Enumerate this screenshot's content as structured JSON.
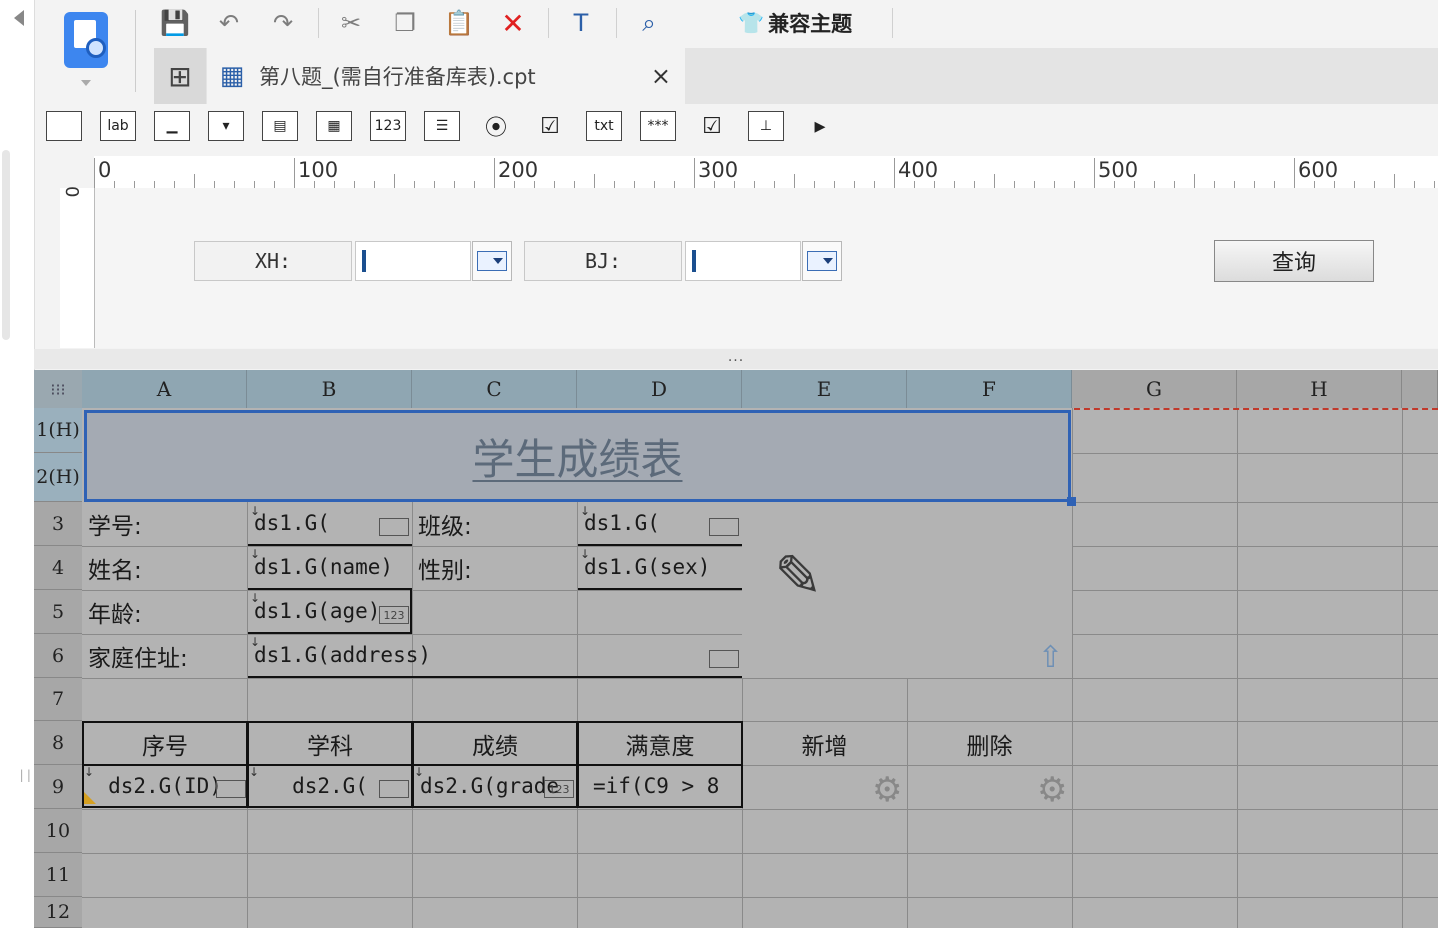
{
  "toolbar": {
    "icons": [
      "save-icon",
      "undo-icon",
      "redo-icon",
      "cut-icon",
      "copy-icon",
      "paste-icon",
      "delete-icon",
      "text-preview-icon",
      "chart-preview-icon"
    ],
    "theme_label": "兼容主题"
  },
  "tab": {
    "file_name": "第八题_(需自行准备库表).cpt",
    "close": "×"
  },
  "widgets": {
    "label_widget": "lab",
    "number_widget": "123",
    "text_widget": "txt",
    "password_widget": "***"
  },
  "ruler": {
    "labels": [
      "0",
      "100",
      "200",
      "300",
      "400",
      "500",
      "600"
    ],
    "left_label": "0"
  },
  "params": {
    "xh_label": "XH:",
    "bj_label": "BJ:",
    "query_button": "查询"
  },
  "divider": "...",
  "grid": {
    "columns": [
      "A",
      "B",
      "C",
      "D",
      "E",
      "F",
      "G",
      "H"
    ],
    "rows": [
      "1(H)",
      "2(H)",
      "3",
      "4",
      "5",
      "6",
      "7",
      "8",
      "9",
      "10",
      "11",
      "12"
    ],
    "title": "学生成绩表",
    "cells": {
      "a3": "学号:",
      "b3": "ds1.G(",
      "c3": "班级:",
      "d3": "ds1.G(",
      "a4": "姓名:",
      "b4": "ds1.G(name)",
      "c4": "性别:",
      "d4": "ds1.G(sex)",
      "a5": "年龄:",
      "b5": "ds1.G(age)",
      "a6": "家庭住址:",
      "b6": "ds1.G(address)",
      "a8": "序号",
      "b8": "学科",
      "c8": "成绩",
      "d8": "满意度",
      "e8": "新增",
      "f8": "删除",
      "a9": "ds2.G(ID)",
      "b9": "ds2.G(",
      "c9": "ds2.G(grade",
      "d9": "=if(C9 > 8"
    }
  },
  "colors": {
    "selection": "#2f62b5",
    "accent": "#3d86ef"
  }
}
